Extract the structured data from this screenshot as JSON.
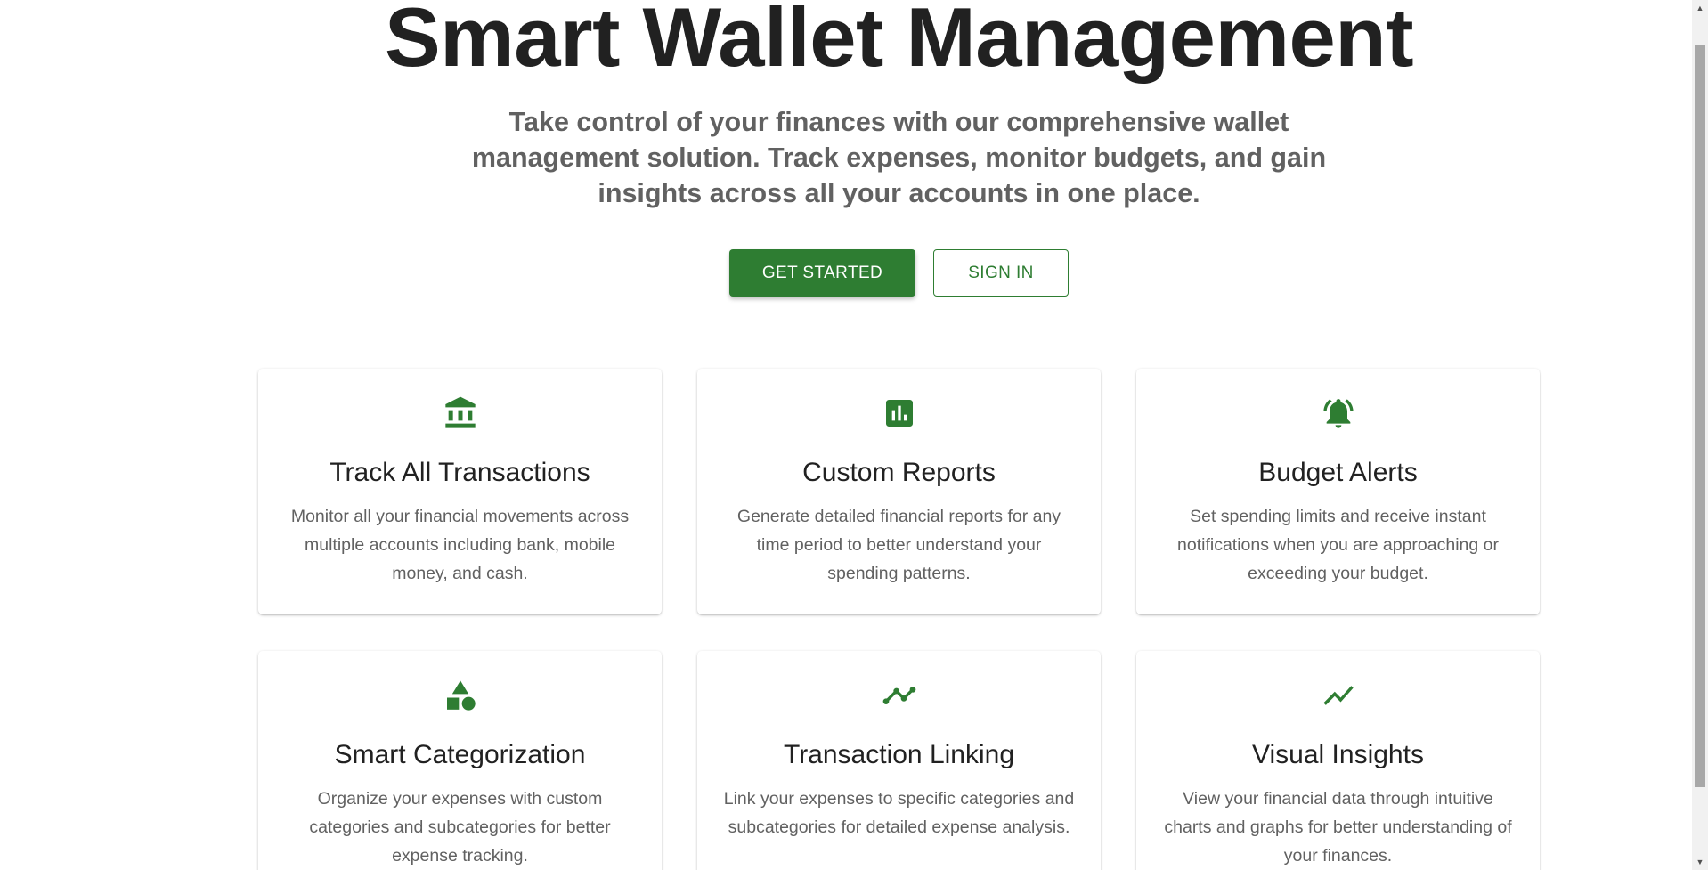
{
  "hero": {
    "title": "Smart Wallet Management",
    "subtitle": "Take control of your finances with our comprehensive wallet management solution. Track expenses, monitor budgets, and gain insights across all your accounts in one place."
  },
  "buttons": {
    "get_started": "GET STARTED",
    "sign_in": "SIGN IN"
  },
  "features": [
    {
      "icon": "bank-icon",
      "title": "Track All Transactions",
      "description": "Monitor all your financial movements across multiple accounts including bank, mobile money, and cash."
    },
    {
      "icon": "bar-chart-icon",
      "title": "Custom Reports",
      "description": "Generate detailed financial reports for any time period to better understand your spending patterns."
    },
    {
      "icon": "alarm-bell-icon",
      "title": "Budget Alerts",
      "description": "Set spending limits and receive instant notifications when you are approaching or exceeding your budget."
    },
    {
      "icon": "category-shapes-icon",
      "title": "Smart Categorization",
      "description": "Organize your expenses with custom categories and subcategories for better expense tracking."
    },
    {
      "icon": "linked-points-icon",
      "title": "Transaction Linking",
      "description": "Link your expenses to specific categories and subcategories for detailed expense analysis."
    },
    {
      "icon": "trending-line-icon",
      "title": "Visual Insights",
      "description": "View your financial data through intuitive charts and graphs for better understanding of your finances."
    }
  ],
  "colors": {
    "primary": "#2e7d32",
    "heading": "#212121",
    "body_text": "#616161"
  }
}
